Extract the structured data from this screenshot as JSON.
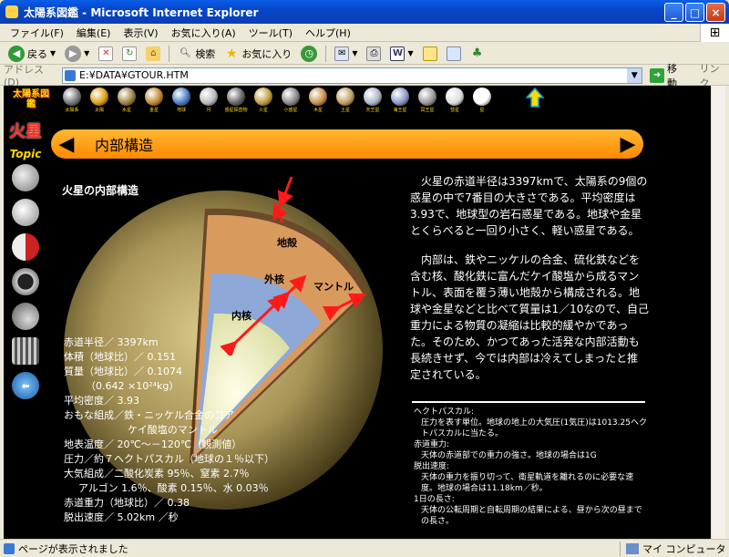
{
  "window": {
    "title": "太陽系図鑑 - Microsoft Internet Explorer",
    "buttons": {
      "minimize": "_",
      "maximize": "□",
      "close": "×"
    }
  },
  "menu": [
    "ファイル(F)",
    "編集(E)",
    "表示(V)",
    "お気に入り(A)",
    "ツール(T)",
    "ヘルプ(H)"
  ],
  "toolbar": {
    "back": "戻る",
    "search": "検索",
    "favorites": "お気に入り"
  },
  "address": {
    "label": "アドレス(D)",
    "value": "E:¥DATA¥GTOUR.HTM",
    "go": "移動",
    "links": "リンク"
  },
  "page": {
    "logo": "太陽系図鑑",
    "planets": [
      {
        "label": "太陽系",
        "color": "#777777"
      },
      {
        "label": "太陽",
        "color": "#e0a010"
      },
      {
        "label": "水星",
        "color": "#a08040"
      },
      {
        "label": "金星",
        "color": "#c08a30"
      },
      {
        "label": "地球",
        "color": "#4a7ec8"
      },
      {
        "label": "月",
        "color": "#bbbbbb"
      },
      {
        "label": "惑星探査物",
        "color": "#666666"
      },
      {
        "label": "火星",
        "color": "#c0a040"
      },
      {
        "label": "小惑星",
        "color": "#888888"
      },
      {
        "label": "木星",
        "color": "#c89048"
      },
      {
        "label": "土星",
        "color": "#c0a060"
      },
      {
        "label": "天王星",
        "color": "#aab8c8"
      },
      {
        "label": "海王星",
        "color": "#8a9ac8"
      },
      {
        "label": "冥王星",
        "color": "#999999"
      },
      {
        "label": "彗星",
        "color": "#dddddd"
      },
      {
        "label": "星",
        "color": "#ffffff"
      }
    ],
    "side_title": "火星",
    "side_topic": "Topic",
    "banner_title": "内部構造",
    "structure_title": "火星の内部構造",
    "layers": {
      "crust": "地殻",
      "mantle": "マントル",
      "outer_core": "外核",
      "inner_core": "内核"
    },
    "specs": [
      "赤道半径／ 3397km",
      "体積（地球比）／ 0.151",
      "質量（地球比）／ 0.1074",
      "（0.642 ×10²⁴kg）",
      "平均密度／ 3.93",
      "おもな組成／鉄・ニッケル合金のコア",
      "ケイ酸塩のマントル",
      "地表温度／ 20℃～－120℃（観測値）",
      "圧力／約７ヘクトパスカル（地球の１％以下）",
      "大気組成／二酸化炭素 95％、窒素 2.7％",
      "アルゴン 1.6％、酸素 0.15％、水 0.03％",
      "赤道重力（地球比）／ 0.38",
      "脱出速度／ 5.02km ／秒"
    ],
    "description": [
      "火星の赤道半径は3397kmで、太陽系の9個の惑星の中で7番目の大きさである。平均密度は3.93で、地球型の岩石惑星である。地球や金星とくらべると一回り小さく、軽い惑星である。",
      "内部は、鉄やニッケルの合金、硫化鉄などを含む核、酸化鉄に富んだケイ酸塩から成るマントル、表面を覆う薄い地殻から構成される。地球や金星などと比べて質量は1／10なので、自己重力による物質の凝縮は比較的緩やかであった。そのため、かつてあった活発な内部活動も長続きせず、今では内部は冷えてしまったと推定されている。"
    ],
    "glossary": [
      {
        "term": "ヘクトパスカル:",
        "def": "圧力を表す単位。地球の地上の大気圧(1気圧)は1013.25ヘクトパスカルに当たる。"
      },
      {
        "term": "赤道重力:",
        "def": "天体の赤道部での重力の強さ。地球の場合は1G"
      },
      {
        "term": "脱出速度:",
        "def": "天体の重力を振り切って、衛星軌道を離れるのに必要な速度。地球の場合は11.18km／秒。"
      },
      {
        "term": "1日の長さ:",
        "def": "天体の公転周期と自転周期の結果による、昼から次の昼までの長さ。"
      }
    ]
  },
  "status": {
    "text": "ページが表示されました",
    "zone": "マイ コンピュータ"
  }
}
